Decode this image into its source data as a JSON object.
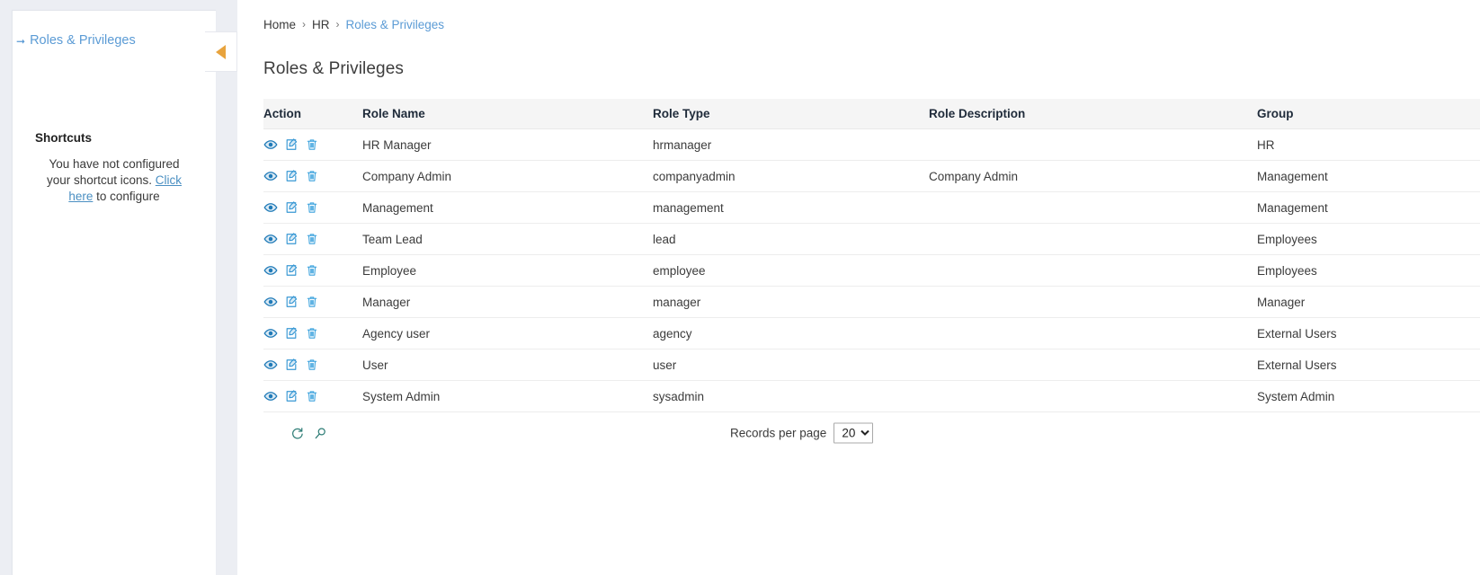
{
  "sidebar": {
    "nav_icon": "arrow-down-right-icon",
    "nav_label": "Roles & Privileges",
    "collapse_icon": "triangle-left-icon",
    "shortcuts": {
      "title": "Shortcuts",
      "message_before": "You have not configured your shortcut icons. ",
      "link_label": "Click here",
      "message_after": " to configure"
    }
  },
  "breadcrumb": {
    "items": [
      {
        "label": "Home",
        "active": false
      },
      {
        "label": "HR",
        "active": false
      },
      {
        "label": "Roles & Privileges",
        "active": true
      }
    ],
    "separator": "›"
  },
  "main": {
    "page_title": "Roles & Privileges"
  },
  "table": {
    "columns": [
      "Action",
      "Role Name",
      "Role Type",
      "Role Description",
      "Group"
    ],
    "row_actions": [
      {
        "name": "view-icon",
        "title": "View"
      },
      {
        "name": "edit-icon",
        "title": "Edit"
      },
      {
        "name": "delete-icon",
        "title": "Delete"
      }
    ],
    "rows": [
      {
        "role_name": "HR Manager",
        "role_type": "hrmanager",
        "role_description": "",
        "group": "HR"
      },
      {
        "role_name": "Company Admin",
        "role_type": "companyadmin",
        "role_description": "Company Admin",
        "group": "Management"
      },
      {
        "role_name": "Management",
        "role_type": "management",
        "role_description": "",
        "group": "Management"
      },
      {
        "role_name": "Team Lead",
        "role_type": "lead",
        "role_description": "",
        "group": "Employees"
      },
      {
        "role_name": "Employee",
        "role_type": "employee",
        "role_description": "",
        "group": "Employees"
      },
      {
        "role_name": "Manager",
        "role_type": "manager",
        "role_description": "",
        "group": "Manager"
      },
      {
        "role_name": "Agency user",
        "role_type": "agency",
        "role_description": "",
        "group": "External Users"
      },
      {
        "role_name": "User",
        "role_type": "user",
        "role_description": "",
        "group": "External Users"
      },
      {
        "role_name": "System Admin",
        "role_type": "sysadmin",
        "role_description": "",
        "group": "System Admin"
      }
    ]
  },
  "footer": {
    "refresh_icon": "refresh-icon",
    "search_icon": "search-icon",
    "records_per_page_label": "Records per page",
    "records_per_page_value": "20",
    "records_per_page_options": [
      "20"
    ]
  },
  "colors": {
    "link_blue": "#5b9bd5",
    "icon_blue": "#2a7fbd",
    "icon_teal": "#2e7d76",
    "accent_orange": "#e8a33d",
    "header_bg": "#f5f5f5",
    "page_bg": "#eceef3"
  }
}
